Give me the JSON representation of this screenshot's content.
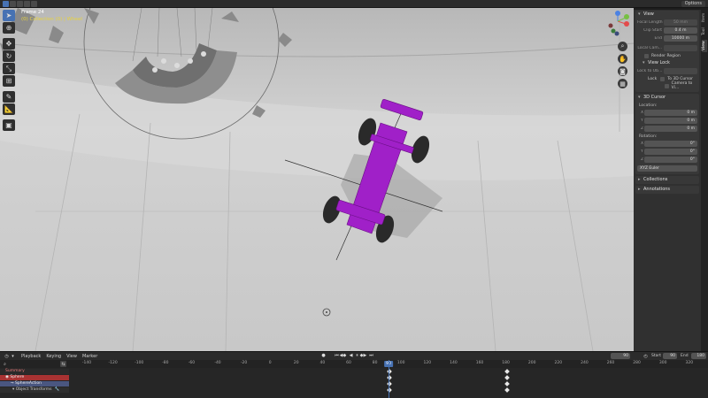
{
  "window": {
    "options_label": "Options"
  },
  "colors": {
    "accent": "#4772b3",
    "object_highlight": "#a020c8",
    "x_axis": "#e34b4b",
    "y_axis": "#76c043",
    "z_axis": "#4b82e3"
  },
  "viewport": {
    "overlay": {
      "line1": "Frame 24",
      "line2": "(0) Collection (0) | Wheel"
    },
    "tools": [
      "select-icon",
      "cursor-icon",
      "move-icon",
      "rotate-icon",
      "scale-icon",
      "transform-icon",
      "annotate-icon",
      "measure-icon",
      "add-cube-icon"
    ],
    "gizmo": {
      "x": "X",
      "y": "Y",
      "z": "Z"
    }
  },
  "sidebar_tabs": [
    "Item",
    "Tool",
    "View"
  ],
  "npanel": {
    "view": {
      "title": "View",
      "focal_length": {
        "label": "Focal Length",
        "value": "50 mm"
      },
      "clip_start": {
        "label": "Clip Start",
        "value": "0.4 m"
      },
      "clip_end": {
        "label": "End",
        "value": "10000 m"
      },
      "local_camera": {
        "label": "Local Cam..."
      },
      "render_region": "Render Region"
    },
    "view_lock": {
      "title": "View Lock",
      "lock_to_object": {
        "label": "Lock to Ob..."
      },
      "lock_label": "Lock",
      "to_3d_cursor": "To 3D Cursor",
      "camera_to_view": "Camera to Vi..."
    },
    "cursor": {
      "title": "3D Cursor",
      "location_label": "Location:",
      "location": [
        {
          "axis": "X",
          "value": "0 m"
        },
        {
          "axis": "Y",
          "value": "0 m"
        },
        {
          "axis": "Z",
          "value": "0 m"
        }
      ],
      "rotation_label": "Rotation:",
      "rotation": [
        {
          "axis": "X",
          "value": "0°"
        },
        {
          "axis": "Y",
          "value": "0°"
        },
        {
          "axis": "Z",
          "value": "0°"
        }
      ],
      "rotation_mode": "XYZ Euler"
    },
    "collections": {
      "title": "Collections"
    },
    "annotations": {
      "title": "Annotations"
    }
  },
  "timeline": {
    "menus": [
      "Playback",
      "Keying",
      "View",
      "Marker"
    ],
    "current_frame": "90",
    "start": {
      "label": "Start",
      "value": "90"
    },
    "end": {
      "label": "End",
      "value": "180"
    },
    "ruler_ticks": [
      "-140",
      "-120",
      "-100",
      "-80",
      "-60",
      "-40",
      "-20",
      "0",
      "20",
      "40",
      "60",
      "80",
      "100",
      "120",
      "140",
      "160",
      "180",
      "200",
      "220",
      "240",
      "260",
      "280",
      "300",
      "320"
    ],
    "cursor_frame": "90",
    "channels": {
      "summary": "Summary",
      "object": "Sphere",
      "action": "SphereAction",
      "group": "Object Transforms"
    }
  }
}
